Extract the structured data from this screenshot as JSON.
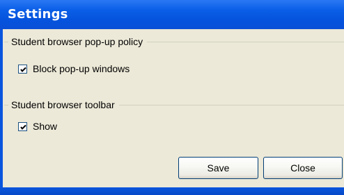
{
  "window": {
    "title": "Settings"
  },
  "popup_policy": {
    "group_label": "Student browser pop-up policy",
    "block_popups": {
      "label": "Block pop-up windows",
      "checked": true
    }
  },
  "toolbar": {
    "group_label": "Student browser toolbar",
    "show": {
      "label": "Show",
      "checked": true
    }
  },
  "buttons": {
    "save_label": "Save",
    "close_label": "Close"
  },
  "colors": {
    "titlebar": "#0a5ee6",
    "client_background": "#ece9d8",
    "button_border": "#003c74"
  }
}
